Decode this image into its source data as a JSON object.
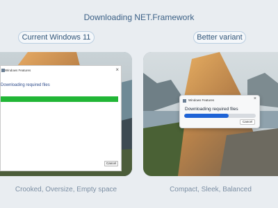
{
  "title": "Downloading NET.Framework",
  "left": {
    "label": "Current Windows 11",
    "caption": "Crooked, Oversize, Empty space",
    "window": {
      "title": "Windows Features",
      "status": "Downloading required files",
      "progress": 1.0,
      "cancel_label": "Cancel",
      "close_glyph": "×",
      "progress_color": "#21b636"
    }
  },
  "right": {
    "label": "Better variant",
    "caption": "Compact, Sleek, Balanced",
    "window": {
      "title": "Windows Features",
      "status": "Downloading required files",
      "progress": 0.62,
      "cancel_label": "Cancel",
      "close_glyph": "×",
      "progress_color": "#1e63d6"
    }
  }
}
